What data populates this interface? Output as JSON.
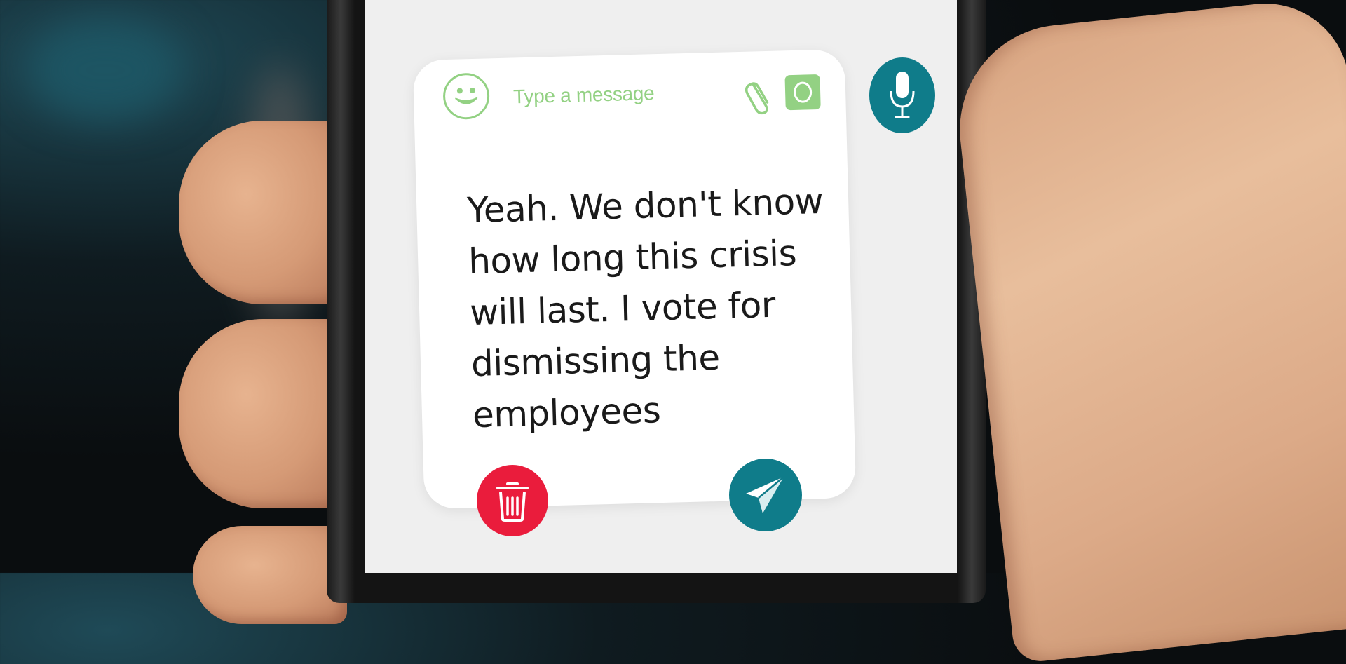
{
  "composer": {
    "placeholder": "Type a message",
    "draft_message": "Yeah. We don't know how long this crisis will last. I vote for dismissing the employees",
    "icons": {
      "emoji": "smiley-face-icon",
      "attach": "paperclip-icon",
      "camera": "camera-icon",
      "mic": "microphone-icon",
      "delete": "trash-icon",
      "send": "paper-plane-icon"
    }
  },
  "colors": {
    "accent_green": "#93d183",
    "teal": "#0f7c8a",
    "delete_red": "#ea1c3c",
    "message_text": "#1a1a1a",
    "card_background": "#ffffff",
    "screen_background": "#efefef"
  }
}
